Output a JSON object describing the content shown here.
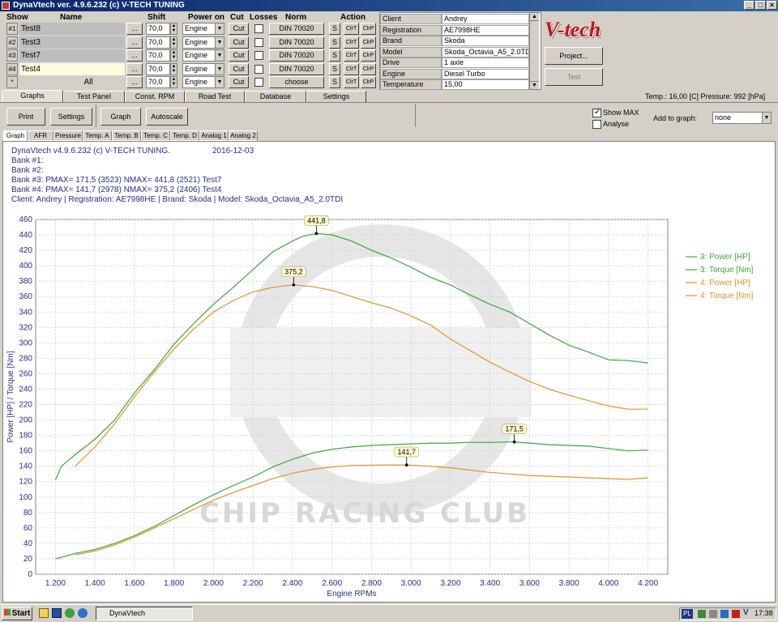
{
  "window": {
    "title": "DynaVtech ver. 4.9.6.232 (c) V-TECH TUNING"
  },
  "columns": {
    "show": "Show",
    "name": "Name",
    "shift": "Shift",
    "power_on": "Power on",
    "cut": "Cut",
    "losses": "Losses",
    "norm": "Norm",
    "action": "Action"
  },
  "rows": [
    {
      "num": "#1",
      "name": "Test8",
      "shift": "70,0",
      "power_on": "Engine",
      "cut": "Cut",
      "norm": "DIN 70020",
      "a1": "S",
      "a2": "ClrT",
      "a3": "ClrP"
    },
    {
      "num": "#2",
      "name": "Test3",
      "shift": "70,0",
      "power_on": "Engine",
      "cut": "Cut",
      "norm": "DIN 70020",
      "a1": "S",
      "a2": "ClrT",
      "a3": "ClrP"
    },
    {
      "num": "#3",
      "name": "Test7",
      "shift": "70,0",
      "power_on": "Engine",
      "cut": "Cut",
      "norm": "DIN 70020",
      "a1": "S",
      "a2": "ClrT",
      "a3": "ClrP"
    },
    {
      "num": "#4",
      "name": "Test4",
      "shift": "70,0",
      "power_on": "Engine",
      "cut": "Cut",
      "norm": "DIN 70020",
      "a1": "S",
      "a2": "ClrT",
      "a3": "ClrP"
    },
    {
      "num": "*",
      "name": "All",
      "shift": "70,0",
      "power_on": "Engine",
      "cut": "Cut",
      "norm": "choose",
      "a1": "S",
      "a2": "ClrT",
      "a3": "ClrP"
    }
  ],
  "client": [
    {
      "k": "Client",
      "v": "Andrey"
    },
    {
      "k": "Registration",
      "v": "AE7998HE"
    },
    {
      "k": "Brand",
      "v": "Skoda"
    },
    {
      "k": "Model",
      "v": "Skoda_Octavia_A5_2.0TDI"
    },
    {
      "k": "Drive",
      "v": "1 axle"
    },
    {
      "k": "Engine",
      "v": "Diesel Turbo"
    },
    {
      "k": "Temperature",
      "v": "15,00"
    }
  ],
  "logo": "V-tech",
  "buttons": {
    "project": "Project...",
    "test": "Test",
    "print": "Print",
    "settings": "Settings",
    "graph": "Graph",
    "autoscale": "Autoscale",
    "dots": "..."
  },
  "tabs": [
    "Graphs",
    "Test Panel",
    "Const. RPM",
    "Road Test",
    "Database",
    "Settings"
  ],
  "status": "Temp.: 16,00 [C]  Pressure: 992 [hPa]",
  "options": {
    "show_max": "Show MAX",
    "analyse": "Analyse",
    "add_to_graph": "Add to graph:",
    "add_value": "none"
  },
  "subtabs": [
    "Graph",
    "AFR",
    "Pressure",
    "Temp. A",
    "Temp. B",
    "Temp. C",
    "Temp. D",
    "Analog 1",
    "Analog 2"
  ],
  "info": {
    "line1": "DynaVtech v4.9.6.232 (c) V-TECH TUNING.",
    "date": "2016-12-03",
    "line2": "Bank #1:",
    "line3": "Bank #2:",
    "line4": "Bank #3:  PMAX= 171,5 (3523)     NMAX= 441,8 (2521)    Test7",
    "line5": "Bank #4:  PMAX= 141,7 (2978)     NMAX= 375,2 (2406)    Test4",
    "line6": "Client: Andrey | Registration: AE7998HE | Brand: Skoda | Model: Skoda_Octavia_A5_2.0TDI"
  },
  "watermark": "CHIP RACING CLUB",
  "chart_data": {
    "type": "line",
    "xlabel": "Engine RPMs",
    "ylabel": "Power [HP] / Torque [Nm]",
    "xlim": [
      1100,
      4300
    ],
    "ylim": [
      0,
      460
    ],
    "xticks": [
      "1.200",
      "1.400",
      "1.600",
      "1.800",
      "2.000",
      "2.200",
      "2.400",
      "2.600",
      "2.800",
      "3.000",
      "3.200",
      "3.400",
      "3.600",
      "3.800",
      "4.000",
      "4.200"
    ],
    "xtick_values": [
      1200,
      1400,
      1600,
      1800,
      2000,
      2200,
      2400,
      2600,
      2800,
      3000,
      3200,
      3400,
      3600,
      3800,
      4000,
      4200
    ],
    "yticks": [
      0,
      20,
      40,
      60,
      80,
      100,
      120,
      140,
      160,
      180,
      200,
      220,
      240,
      260,
      280,
      300,
      320,
      340,
      360,
      380,
      400,
      420,
      440,
      460
    ],
    "legend_position": "right",
    "series": [
      {
        "name": "3: Power [HP]",
        "color": "#3aa83a",
        "x": [
          1200,
          1300,
          1400,
          1500,
          1600,
          1700,
          1800,
          1900,
          2000,
          2100,
          2200,
          2300,
          2400,
          2500,
          2600,
          2700,
          2800,
          2900,
          3000,
          3100,
          3200,
          3300,
          3400,
          3500,
          3523,
          3600,
          3700,
          3800,
          3900,
          4000,
          4100,
          4200
        ],
        "y": [
          20,
          27,
          32,
          40,
          50,
          62,
          76,
          90,
          103,
          115,
          126,
          139,
          149,
          157,
          162,
          165,
          167,
          168,
          169,
          170,
          170,
          171,
          171,
          171.5,
          171.5,
          170,
          168,
          167,
          166,
          163,
          160,
          161
        ]
      },
      {
        "name": "3: Torque [Nm]",
        "color": "#3aa83a",
        "x": [
          1200,
          1230,
          1300,
          1400,
          1500,
          1600,
          1700,
          1800,
          1900,
          2000,
          2100,
          2200,
          2300,
          2400,
          2450,
          2521,
          2600,
          2700,
          2800,
          2900,
          3000,
          3100,
          3200,
          3300,
          3400,
          3500,
          3600,
          3700,
          3800,
          3900,
          4000,
          4100,
          4200
        ],
        "y": [
          122,
          140,
          155,
          175,
          200,
          235,
          265,
          298,
          325,
          350,
          372,
          395,
          418,
          432,
          438,
          441.8,
          440,
          432,
          420,
          410,
          398,
          385,
          375,
          362,
          350,
          340,
          325,
          310,
          297,
          288,
          278,
          277,
          274
        ]
      },
      {
        "name": "4: Power [HP]",
        "color": "#e0922e",
        "x": [
          1300,
          1400,
          1500,
          1600,
          1700,
          1800,
          1900,
          2000,
          2100,
          2200,
          2300,
          2400,
          2500,
          2600,
          2700,
          2800,
          2900,
          2978,
          3100,
          3200,
          3300,
          3400,
          3500,
          3600,
          3700,
          3800,
          3900,
          4000,
          4100,
          4200
        ],
        "y": [
          25,
          30,
          38,
          48,
          60,
          72,
          84,
          96,
          106,
          115,
          124,
          131,
          136,
          139,
          141,
          141.5,
          141.7,
          141.7,
          140,
          138,
          135,
          132,
          130,
          128,
          127,
          126,
          125,
          124,
          123,
          125
        ]
      },
      {
        "name": "4: Torque [Nm]",
        "color": "#e0922e",
        "x": [
          1300,
          1400,
          1500,
          1600,
          1700,
          1800,
          1900,
          2000,
          2100,
          2200,
          2300,
          2406,
          2500,
          2600,
          2700,
          2800,
          2900,
          3000,
          3100,
          3200,
          3300,
          3400,
          3500,
          3600,
          3700,
          3800,
          3900,
          4000,
          4100,
          4200
        ],
        "y": [
          140,
          165,
          195,
          230,
          262,
          292,
          318,
          340,
          355,
          366,
          372,
          375.2,
          373,
          368,
          360,
          352,
          345,
          335,
          323,
          305,
          290,
          275,
          262,
          250,
          240,
          232,
          225,
          218,
          214,
          214
        ]
      }
    ],
    "annotations": [
      {
        "x": 2521,
        "y": 441.8,
        "label": "441,8"
      },
      {
        "x": 2406,
        "y": 375.2,
        "label": "375,2"
      },
      {
        "x": 3523,
        "y": 171.5,
        "label": "171,5"
      },
      {
        "x": 2978,
        "y": 141.7,
        "label": "141,7"
      }
    ]
  },
  "taskbar": {
    "start": "Start",
    "task": "DynaVtech",
    "lang": "PL",
    "clock": "17:38"
  }
}
